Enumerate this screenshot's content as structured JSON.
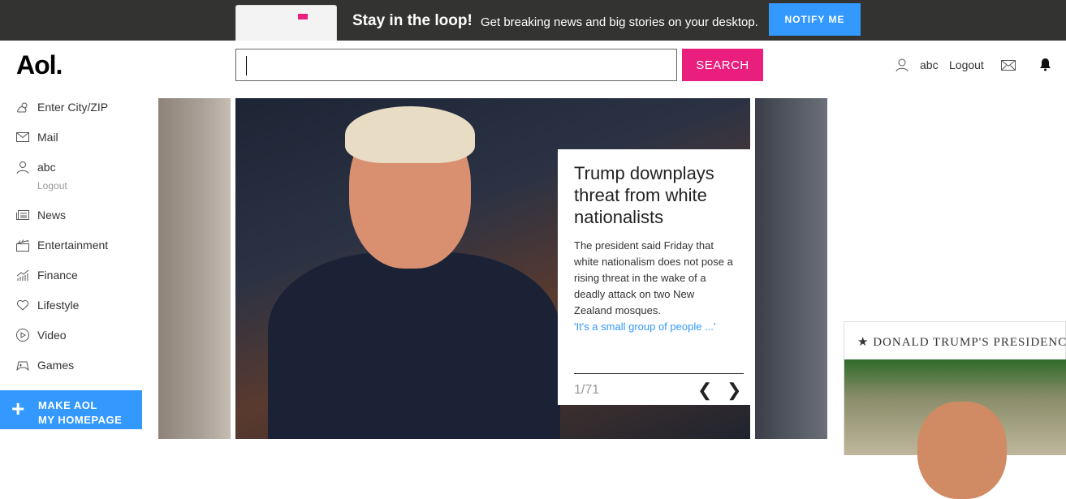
{
  "banner": {
    "title": "Stay in the loop!",
    "subtitle": "Get breaking news and big stories on your desktop.",
    "notify_label": "NOTIFY ME"
  },
  "header": {
    "logo": "Aol.",
    "search_value": "",
    "search_label": "SEARCH",
    "user": "abc",
    "logout": "Logout"
  },
  "sidebar": {
    "items": [
      {
        "label": "Enter City/ZIP",
        "icon": "weather-icon"
      },
      {
        "label": "Mail",
        "icon": "mail-icon"
      },
      {
        "label": "abc",
        "icon": "user-icon"
      },
      {
        "label": "News",
        "icon": "news-icon"
      },
      {
        "label": "Entertainment",
        "icon": "clapper-icon"
      },
      {
        "label": "Finance",
        "icon": "chart-icon"
      },
      {
        "label": "Lifestyle",
        "icon": "heart-icon"
      },
      {
        "label": "Video",
        "icon": "play-icon"
      },
      {
        "label": "Games",
        "icon": "gamepad-icon"
      }
    ],
    "logout": "Logout",
    "make_line1": "MAKE AOL",
    "make_line2": "MY HOMEPAGE"
  },
  "story": {
    "headline": "Trump downplays threat from white nationalists",
    "summary": "The president said Friday that white nationalism does not pose a rising threat in the wake of a deadly attack on two New Zealand mosques.",
    "link": "'It's a small group of people ...'",
    "counter": "1/71"
  },
  "promo": {
    "title": "DONALD TRUMP'S PRESIDENCY"
  },
  "colors": {
    "accent_blue": "#3399ff",
    "search_pink": "#e91e7d",
    "banner_bg": "#333331"
  }
}
